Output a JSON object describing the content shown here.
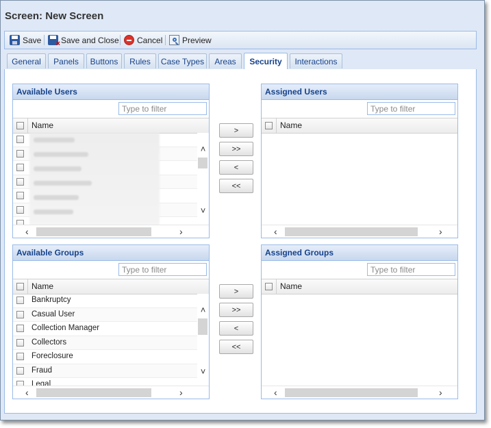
{
  "title": "Screen: New Screen",
  "toolbar": {
    "save": "Save",
    "save_close": "Save and Close",
    "cancel": "Cancel",
    "preview": "Preview"
  },
  "tabs": [
    {
      "label": "General"
    },
    {
      "label": "Panels"
    },
    {
      "label": "Buttons"
    },
    {
      "label": "Rules"
    },
    {
      "label": "Case Types"
    },
    {
      "label": "Areas"
    },
    {
      "label": "Security",
      "active": true
    },
    {
      "label": "Interactions"
    }
  ],
  "available_users": {
    "title": "Available Users",
    "filter_placeholder": "Type to filter",
    "col_name": "Name"
  },
  "assigned_users": {
    "title": "Assigned Users",
    "filter_placeholder": "Type to filter",
    "col_name": "Name"
  },
  "available_groups": {
    "title": "Available Groups",
    "filter_placeholder": "Type to filter",
    "col_name": "Name",
    "rows": [
      "Bankruptcy",
      "Casual User",
      "Collection Manager",
      "Collectors",
      "Foreclosure",
      "Fraud",
      "Legal"
    ]
  },
  "assigned_groups": {
    "title": "Assigned Groups",
    "filter_placeholder": "Type to filter",
    "col_name": "Name"
  },
  "move_buttons": {
    "add": ">",
    "add_all": ">>",
    "remove": "<",
    "remove_all": "<<"
  }
}
